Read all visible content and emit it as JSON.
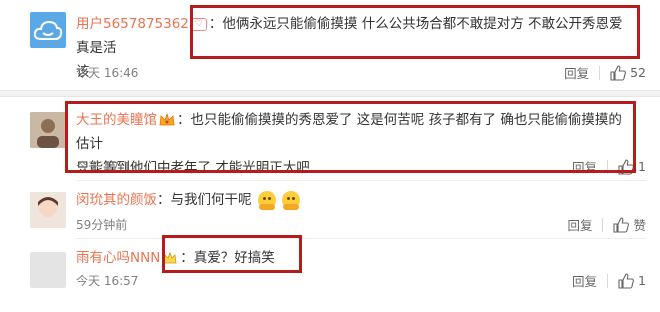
{
  "comments": [
    {
      "username": "用户5657875362",
      "badge": "♡",
      "separator": "：",
      "text_line1": "他俩永远只能偷偷摸摸 什么公共场合都不敢提对方 不敢公开秀恩爱 真是活",
      "text_line2": "该",
      "time": "今天 16:46",
      "reply_label": "回复",
      "like_count": "52"
    },
    {
      "username": "大王的美瞳馆",
      "separator": "：",
      "text_line1": "也只能偷偷摸摸的秀恩爱了 这是何苦呢 孩子都有了 确也只能偷偷摸摸的 估计",
      "text_line2": "只能等到他们中老年了 才能光明正大吧",
      "time": "今天 17:12",
      "reply_label": "回复",
      "like_count": "1"
    },
    {
      "username": "闵玧其的颜饭",
      "separator": "：",
      "text": "与我们何干呢",
      "time": "59分钟前",
      "reply_label": "回复",
      "like_label": "赞"
    },
    {
      "username": "雨有心吗NNN",
      "separator": "：",
      "text": "真爱？好搞笑",
      "time": "今天 16:57",
      "reply_label": "回复",
      "like_count": "1"
    }
  ],
  "colors": {
    "username": "#eb7350",
    "highlight_box": "#b71c1c",
    "meta": "#808080"
  }
}
